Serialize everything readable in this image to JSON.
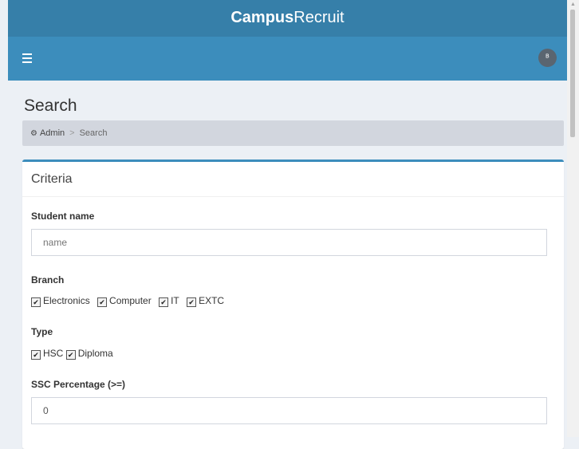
{
  "app": {
    "brand_bold": "Campus",
    "brand_light": "Recruit"
  },
  "navbar": {
    "menu_icon": "hamburger-icon",
    "avatar_icon": "user-icon",
    "avatar_glyph": "ᴮ"
  },
  "page": {
    "title": "Search"
  },
  "breadcrumb": {
    "home_icon": "dashboard-icon",
    "home": "Admin",
    "separator": ">",
    "current": "Search"
  },
  "criteria": {
    "title": "Criteria",
    "student_name": {
      "label": "Student name",
      "placeholder": "name",
      "value": ""
    },
    "branch": {
      "label": "Branch",
      "options": [
        {
          "label": "Electronics",
          "checked": true
        },
        {
          "label": "Computer",
          "checked": true
        },
        {
          "label": "IT",
          "checked": true
        },
        {
          "label": "EXTC",
          "checked": true
        }
      ]
    },
    "type": {
      "label": "Type",
      "options": [
        {
          "label": "HSC",
          "checked": true
        },
        {
          "label": "Diploma",
          "checked": true
        }
      ]
    },
    "ssc": {
      "label": "SSC Percentage (>=)",
      "value": "0"
    }
  },
  "colors": {
    "header_dark": "#367fa9",
    "header": "#3c8dbc",
    "background": "#ecf0f5"
  }
}
